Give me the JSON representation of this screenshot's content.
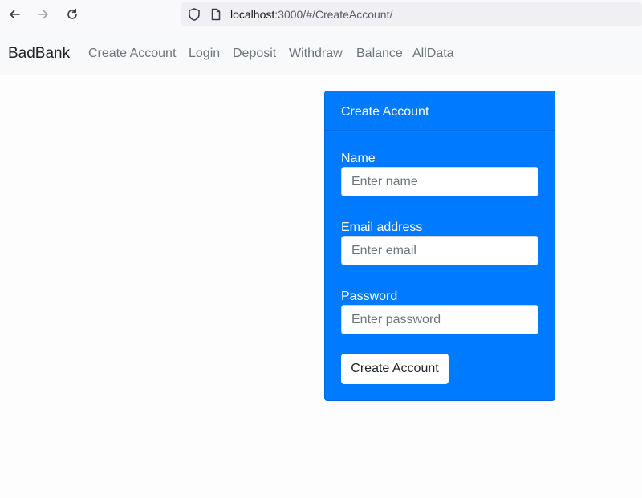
{
  "browser": {
    "url_host": "localhost",
    "url_path": ":3000/#/CreateAccount/"
  },
  "navbar": {
    "brand": "BadBank",
    "links": [
      "Create Account",
      "Login",
      "Deposit",
      "Withdraw",
      "Balance",
      "AllData"
    ]
  },
  "card": {
    "header": "Create Account",
    "fields": [
      {
        "label": "Name",
        "placeholder": "Enter name"
      },
      {
        "label": "Email address",
        "placeholder": "Enter email"
      },
      {
        "label": "Password",
        "placeholder": "Enter password"
      }
    ],
    "submit_label": "Create Account"
  },
  "colors": {
    "card_bg": "#007bff",
    "navbar_bg": "#f8f9fa"
  },
  "icons": [
    "back-arrow-icon",
    "forward-arrow-icon",
    "reload-icon",
    "shield-icon",
    "page-icon"
  ]
}
